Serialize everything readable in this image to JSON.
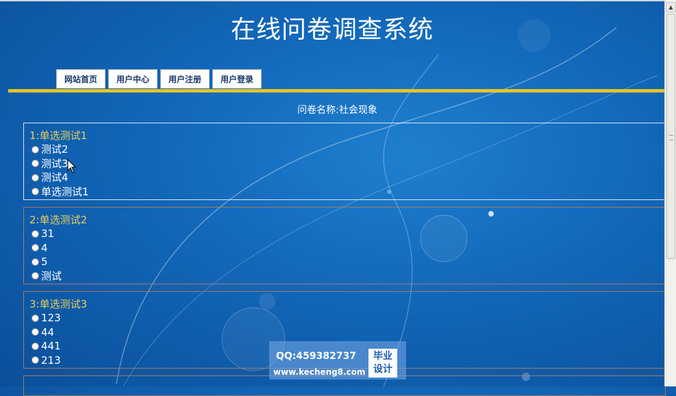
{
  "page_title": "在线问卷调查系统",
  "nav_tabs": [
    {
      "label": "网站首页"
    },
    {
      "label": "用户中心"
    },
    {
      "label": "用户注册"
    },
    {
      "label": "用户登录"
    }
  ],
  "survey": {
    "label": "问卷名称:",
    "name": "社会现象",
    "questions": [
      {
        "title": "1:单选测试1",
        "options": [
          "测试2",
          "测试3",
          "测试4",
          "单选测试1"
        ]
      },
      {
        "title": "2:单选测试2",
        "options": [
          "31",
          "4",
          "5",
          "测试"
        ]
      },
      {
        "title": "3:单选测试3",
        "options": [
          "123",
          "44",
          "441",
          "213"
        ]
      }
    ]
  },
  "watermark": {
    "qq": "QQ:459382737",
    "url": "www.kecheng8.com",
    "badge_line1": "毕业",
    "badge_line2": "设计"
  },
  "colors": {
    "background": "#1266b8",
    "tab_underline": "#e5c423",
    "question_title": "#e7cf5a",
    "question_border": "#a87a55"
  }
}
